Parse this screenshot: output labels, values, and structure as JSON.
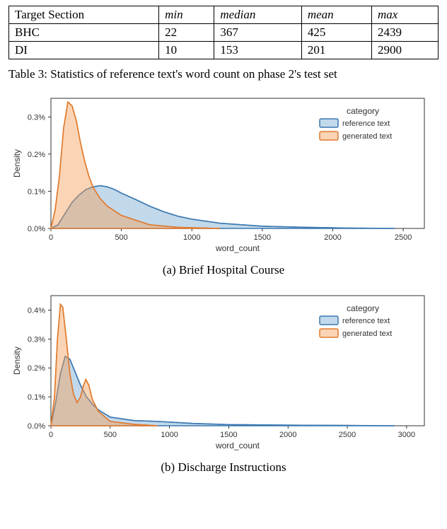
{
  "table": {
    "headers": [
      "Target Section",
      "min",
      "median",
      "mean",
      "max"
    ],
    "rows": [
      {
        "label": "BHC",
        "min": "22",
        "median": "367",
        "mean": "425",
        "max": "2439"
      },
      {
        "label": "DI",
        "min": "10",
        "median": "153",
        "mean": "201",
        "max": "2900"
      }
    ]
  },
  "caption": "Table 3: Statistics of reference text's word count on phase 2's test set",
  "charts": {
    "a": {
      "title": "(a) Brief Hospital Course"
    },
    "b": {
      "title": "(b) Discharge Instructions"
    }
  },
  "chart_data": [
    {
      "type": "area",
      "title": "(a) Brief Hospital Course",
      "xlabel": "word_count",
      "ylabel": "Density",
      "xlim": [
        0,
        2650
      ],
      "ylim": [
        0,
        0.0035
      ],
      "xticks": [
        0,
        500,
        1000,
        1500,
        2000,
        2500
      ],
      "yticks": [
        0.0,
        0.001,
        0.002,
        0.003
      ],
      "ytick_labels": [
        "0.0%",
        "0.1%",
        "0.2%",
        "0.3%"
      ],
      "legend_title": "category",
      "series": [
        {
          "name": "reference text",
          "color": "#6fa8d6",
          "x": [
            0,
            50,
            100,
            150,
            200,
            250,
            300,
            350,
            400,
            450,
            500,
            600,
            700,
            800,
            900,
            1000,
            1200,
            1500,
            1800,
            2100,
            2439
          ],
          "values": [
            0.0,
            0.0001,
            0.0004,
            0.0007,
            0.0009,
            0.00105,
            0.00112,
            0.00115,
            0.00112,
            0.00105,
            0.00095,
            0.00078,
            0.0006,
            0.00045,
            0.00033,
            0.00025,
            0.00014,
            6e-05,
            3e-05,
            1e-05,
            0.0
          ]
        },
        {
          "name": "generated text",
          "color": "#f0a05a",
          "x": [
            0,
            30,
            60,
            90,
            120,
            150,
            180,
            210,
            240,
            270,
            300,
            350,
            400,
            500,
            700,
            900,
            1200
          ],
          "values": [
            0.0,
            0.0005,
            0.0014,
            0.0027,
            0.0034,
            0.0033,
            0.0029,
            0.0023,
            0.0018,
            0.0014,
            0.0011,
            0.0008,
            0.0006,
            0.00035,
            0.0001,
            3e-05,
            0.0
          ]
        }
      ]
    },
    {
      "type": "area",
      "title": "(b) Discharge Instructions",
      "xlabel": "word_count",
      "ylabel": "Density",
      "xlim": [
        0,
        3150
      ],
      "ylim": [
        0,
        0.0045
      ],
      "xticks": [
        0,
        500,
        1000,
        1500,
        2000,
        2500,
        3000
      ],
      "yticks": [
        0.0,
        0.001,
        0.002,
        0.003,
        0.004
      ],
      "ytick_labels": [
        "0.0%",
        "0.1%",
        "0.2%",
        "0.3%",
        "0.4%"
      ],
      "legend_title": "category",
      "series": [
        {
          "name": "reference text",
          "color": "#6fa8d6",
          "x": [
            0,
            40,
            80,
            120,
            160,
            200,
            250,
            300,
            350,
            400,
            500,
            700,
            900,
            1200,
            1500,
            2000,
            2500,
            2900
          ],
          "values": [
            0.0,
            0.0008,
            0.0018,
            0.0024,
            0.0023,
            0.0019,
            0.0014,
            0.001,
            0.00075,
            0.00055,
            0.0003,
            0.00018,
            0.00015,
            8e-05,
            4e-05,
            2e-05,
            1e-05,
            0.0
          ]
        },
        {
          "name": "generated text",
          "color": "#f0a05a",
          "x": [
            0,
            30,
            55,
            80,
            100,
            130,
            160,
            190,
            220,
            250,
            275,
            295,
            320,
            350,
            400,
            500,
            700,
            900
          ],
          "values": [
            0.0,
            0.001,
            0.003,
            0.0042,
            0.0041,
            0.003,
            0.0018,
            0.0011,
            0.0008,
            0.001,
            0.0014,
            0.0016,
            0.0014,
            0.0009,
            0.0005,
            0.00015,
            5e-05,
            0.0
          ]
        }
      ]
    }
  ],
  "legend": {
    "title": "category",
    "items": [
      "reference text",
      "generated text"
    ]
  }
}
